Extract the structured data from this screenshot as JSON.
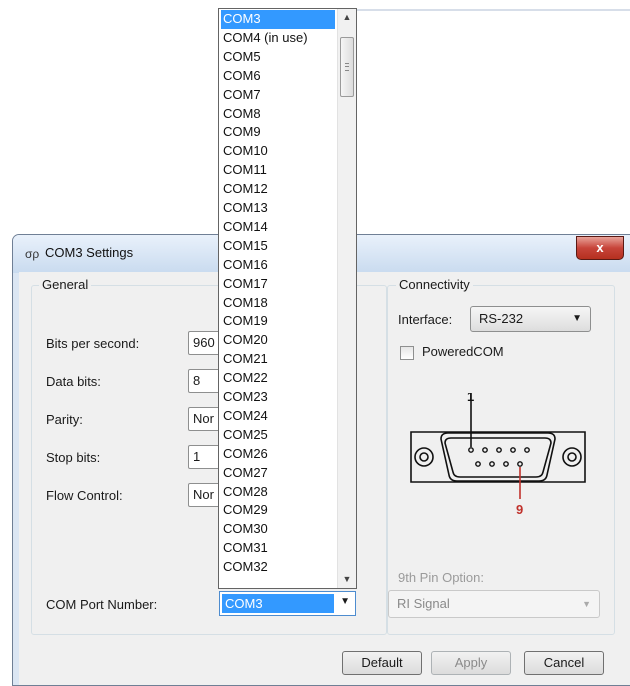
{
  "window": {
    "title": "COM3 Settings",
    "icon": "com-port-icon",
    "close_label": "x"
  },
  "general": {
    "legend": "General",
    "fields": [
      {
        "label": "Bits per second:",
        "value": "960"
      },
      {
        "label": "Data bits:",
        "value": "8"
      },
      {
        "label": "Parity:",
        "value": "Nor"
      },
      {
        "label": "Stop bits:",
        "value": "1"
      },
      {
        "label": "Flow Control:",
        "value": "Nor"
      }
    ],
    "com_port_label": "COM Port Number:",
    "com_port_value": "COM3"
  },
  "connectivity": {
    "legend": "Connectivity",
    "interface_label": "Interface:",
    "interface_value": "RS-232",
    "powered_label": "PoweredCOM",
    "powered_checked": false,
    "pin1_label": "1",
    "pin9_label": "9",
    "pin9_color": "#c0322c",
    "ninth_pin_label": "9th Pin Option:",
    "ninth_pin_value": "RI Signal"
  },
  "buttons": {
    "default": "Default",
    "apply": "Apply",
    "cancel": "Cancel"
  },
  "dropdown": {
    "selected": "COM3",
    "items": [
      "COM3",
      "COM4 (in use)",
      "COM5",
      "COM6",
      "COM7",
      "COM8",
      "COM9",
      "COM10",
      "COM11",
      "COM12",
      "COM13",
      "COM14",
      "COM15",
      "COM16",
      "COM17",
      "COM18",
      "COM19",
      "COM20",
      "COM21",
      "COM22",
      "COM23",
      "COM24",
      "COM25",
      "COM26",
      "COM27",
      "COM28",
      "COM29",
      "COM30",
      "COM31",
      "COM32"
    ]
  },
  "colors": {
    "selection": "#3399ff",
    "close_button": "#c7443a"
  }
}
